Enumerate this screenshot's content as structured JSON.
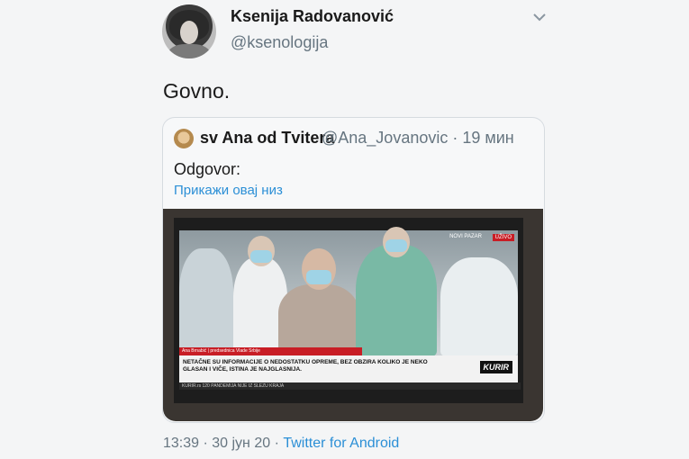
{
  "author": {
    "name": "Ksenija Radovanović",
    "handle": "@ksenologija",
    "avatar_icon": "user-avatar"
  },
  "tweet": {
    "text": "Govno."
  },
  "quoted": {
    "name": "sv Ana od Tvitera",
    "handle": "@Ana_Jovanovic · 19 мин",
    "reply_label": "Odgovor:",
    "show_thread": "Прикажи овај низ",
    "media": {
      "channel_tag": "UŽIVO",
      "location_tag": "NOVI PAZAR",
      "speaker_caption": "Ana Brnabić | predsednica Vlade Srbije",
      "headline": "NETAČNE SU INFORMACIJE O NEDOSTATKU OPREME, BEZ OBZIRA KOLIKO JE NEKO GLASAN I VIČE, ISTINA JE NAJGLASNIJA.",
      "logo": "KURIR",
      "bottom_ticker": "KURIR.rs   120 PANDEMIJA NIJE IZ SLEZU KRAJA"
    }
  },
  "footer": {
    "time": "13:39 · 30 јун 20 · ",
    "source": "Twitter for Android"
  }
}
